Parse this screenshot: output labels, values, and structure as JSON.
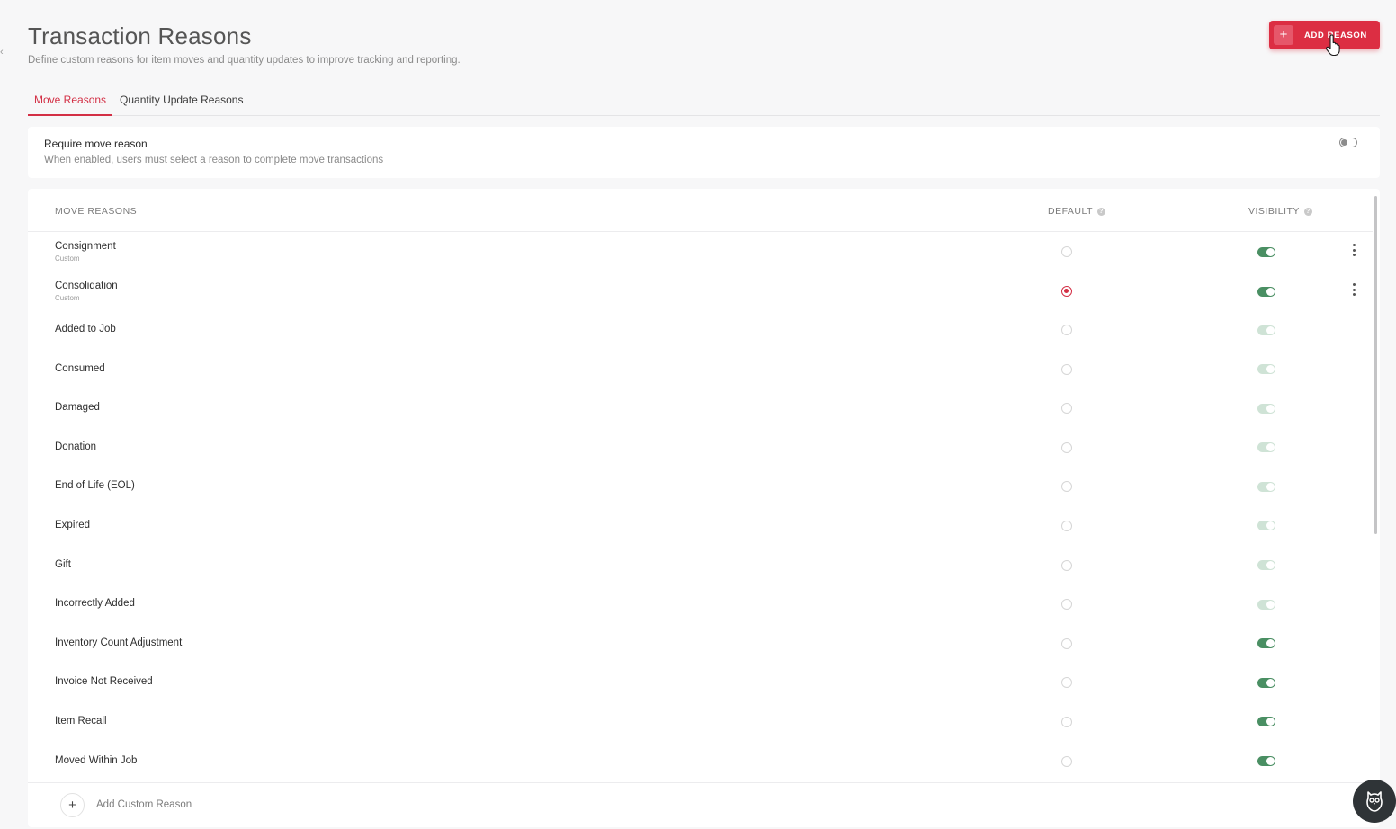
{
  "header": {
    "title": "Transaction Reasons",
    "subtitle": "Define custom reasons for item moves and quantity updates to improve tracking and reporting.",
    "add_button_label": "ADD REASON"
  },
  "tabs": [
    {
      "label": "Move Reasons",
      "active": true
    },
    {
      "label": "Quantity Update Reasons",
      "active": false
    }
  ],
  "require_setting": {
    "title": "Require move reason",
    "description": "When enabled, users must select a reason to complete move transactions",
    "enabled": false
  },
  "table": {
    "columns": {
      "name": "MOVE REASONS",
      "default": "DEFAULT",
      "visibility": "VISIBILITY"
    },
    "rows": [
      {
        "name": "Consignment",
        "subtitle": "Custom",
        "default": false,
        "visible": true,
        "editable": true
      },
      {
        "name": "Consolidation",
        "subtitle": "Custom",
        "default": true,
        "visible": true,
        "editable": true
      },
      {
        "name": "Added to Job",
        "subtitle": "",
        "default": false,
        "visible": true,
        "editable": false
      },
      {
        "name": "Consumed",
        "subtitle": "",
        "default": false,
        "visible": true,
        "editable": false
      },
      {
        "name": "Damaged",
        "subtitle": "",
        "default": false,
        "visible": true,
        "editable": false
      },
      {
        "name": "Donation",
        "subtitle": "",
        "default": false,
        "visible": true,
        "editable": false
      },
      {
        "name": "End of Life (EOL)",
        "subtitle": "",
        "default": false,
        "visible": true,
        "editable": false
      },
      {
        "name": "Expired",
        "subtitle": "",
        "default": false,
        "visible": true,
        "editable": false
      },
      {
        "name": "Gift",
        "subtitle": "",
        "default": false,
        "visible": true,
        "editable": false
      },
      {
        "name": "Incorrectly Added",
        "subtitle": "",
        "default": false,
        "visible": true,
        "editable": false
      },
      {
        "name": "Inventory Count Adjustment",
        "subtitle": "",
        "default": false,
        "visible": true,
        "editable": true
      },
      {
        "name": "Invoice Not Received",
        "subtitle": "",
        "default": false,
        "visible": true,
        "editable": true
      },
      {
        "name": "Item Recall",
        "subtitle": "",
        "default": false,
        "visible": true,
        "editable": true
      },
      {
        "name": "Moved Within Job",
        "subtitle": "",
        "default": false,
        "visible": true,
        "editable": true
      }
    ],
    "add_custom_label": "Add Custom Reason"
  },
  "colors": {
    "accent": "#dc2e43",
    "toggle_on": "#4a8f63",
    "toggle_disabled": "#cfe3d6"
  },
  "icons": {
    "add": "plus-icon",
    "info": "info-icon",
    "more": "kebab-icon",
    "help": "owl-help-icon"
  }
}
